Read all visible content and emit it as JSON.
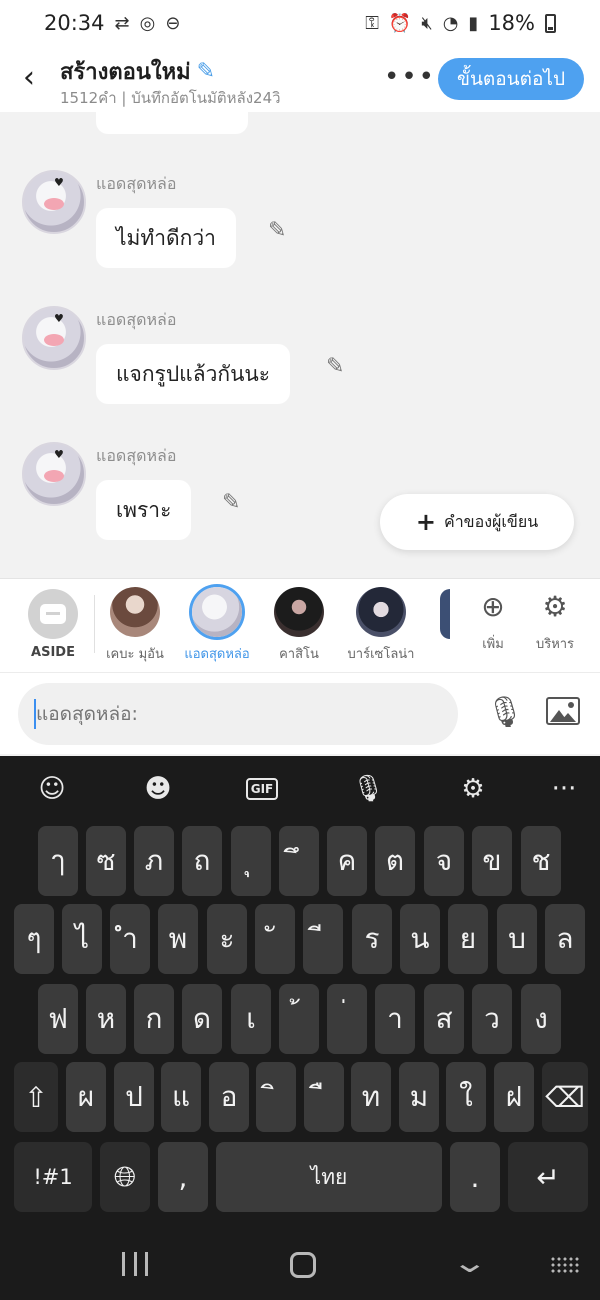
{
  "status_bar": {
    "time": "20:34",
    "battery_text": "18%"
  },
  "header": {
    "back_icon": "‹",
    "title": "สร้างตอนใหม่",
    "subtitle": "1512คำ | บันทึกอัตโนมัติหลัง24วิ",
    "more_icon": "•••",
    "next_label": "ขั้นตอนต่อไป"
  },
  "messages": [
    {
      "sender": "แอดสุดหล่อ",
      "text": "ไม่ทำดีกว่า"
    },
    {
      "sender": "แอดสุดหล่อ",
      "text": "แจกรูปแล้วกันนะ"
    },
    {
      "sender": "แอดสุดหล่อ",
      "text": "เพราะ"
    }
  ],
  "author_button": {
    "plus": "+",
    "label": "คำของผู้เขียน"
  },
  "character_bar": {
    "aside_label": "ASIDE",
    "characters": [
      {
        "name": "เคบะ มุอัน"
      },
      {
        "name": "แอดสุดหล่อ"
      },
      {
        "name": "คาสิโน"
      },
      {
        "name": "บาร์เซโลน่า"
      }
    ],
    "add_label": "เพิ่ม",
    "manage_label": "บริหาร"
  },
  "input": {
    "placeholder": "แอดสุดหล่อ:"
  },
  "keyboard": {
    "row1": [
      "ๅ",
      "ซ",
      "ภ",
      "ถ",
      "ุ",
      "ึ",
      "ค",
      "ต",
      "จ",
      "ข",
      "ช"
    ],
    "row2": [
      "ๆ",
      "ไ",
      "ำ",
      "พ",
      "ะ",
      "ั",
      "ี",
      "ร",
      "น",
      "ย",
      "บ",
      "ล"
    ],
    "row3": [
      "ฟ",
      "ห",
      "ก",
      "ด",
      "เ",
      "้",
      "่",
      "า",
      "ส",
      "ว",
      "ง"
    ],
    "row4": [
      "ผ",
      "ป",
      "แ",
      "อ",
      "ิ",
      "ื",
      "ท",
      "ม",
      "ใ",
      "ฝ"
    ],
    "symbols_label": "!#1",
    "comma": ",",
    "space_label": "ไทย",
    "period": "."
  },
  "colors": {
    "accent": "#4ea1f0",
    "keyboard_bg": "#1b1b1b",
    "key_bg": "#3b3b3b"
  }
}
